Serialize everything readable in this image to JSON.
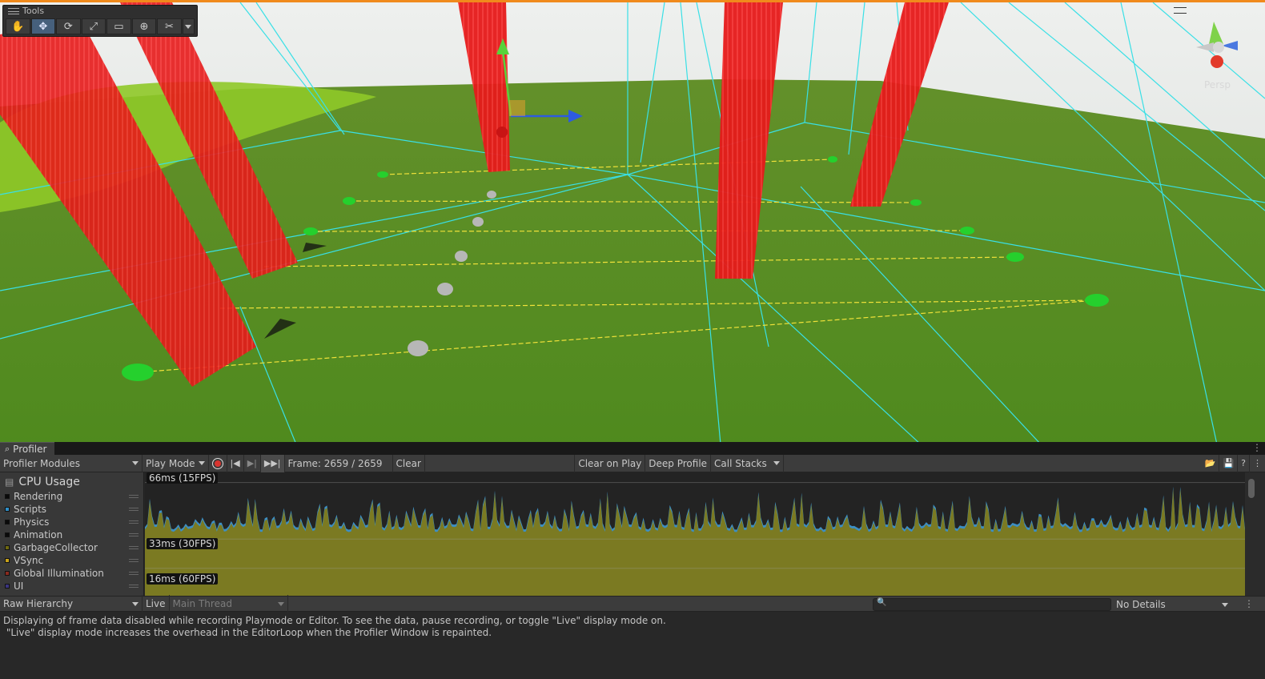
{
  "scene": {
    "tools_title": "Tools",
    "tool_icons": [
      "hand-icon",
      "move-icon",
      "rotate-icon",
      "scale-icon",
      "rect-icon",
      "transform-icon",
      "custom-tool-icon"
    ],
    "active_tool": "move-icon",
    "gizmo_label": "Persp"
  },
  "profiler": {
    "tab_title": "Profiler",
    "modules_dropdown": "Profiler Modules",
    "target_dropdown": "Play Mode",
    "frame_text": "Frame: 2659 / 2659",
    "clear_label": "Clear",
    "clear_on_play_label": "Clear on Play",
    "deep_profile_label": "Deep Profile",
    "call_stacks_label": "Call Stacks",
    "module_title": "CPU Usage",
    "modules": [
      {
        "label": "Rendering",
        "color": "#0a0a0a"
      },
      {
        "label": "Scripts",
        "color": "#2f8fc8"
      },
      {
        "label": "Physics",
        "color": "#0a0a0a"
      },
      {
        "label": "Animation",
        "color": "#0a0a0a"
      },
      {
        "label": "GarbageCollector",
        "color": "#6f6a10"
      },
      {
        "label": "VSync",
        "color": "#c8a21a"
      },
      {
        "label": "Global Illumination",
        "color": "#8a2a1e"
      },
      {
        "label": "UI",
        "color": "#3b3580"
      }
    ],
    "ticks": [
      "66ms (15FPS)",
      "33ms (30FPS)",
      "16ms (60FPS)"
    ],
    "hierarchy_dropdown": "Raw Hierarchy",
    "live_label": "Live",
    "thread_dropdown": "Main Thread",
    "details_dropdown": "No Details",
    "message_line1": "Displaying of frame data disabled while recording Playmode or Editor. To see the data, pause recording, or toggle \"Live\" display mode on.",
    "message_line2": " \"Live\" display mode increases the overhead in the EditorLoop when the Profiler Window is repainted."
  },
  "chart_data": {
    "type": "area",
    "ylabel": "",
    "yticks": [
      {
        "label": "66ms (15FPS)",
        "value": 66
      },
      {
        "label": "33ms (30FPS)",
        "value": 33
      },
      {
        "label": "16ms (60FPS)",
        "value": 16
      }
    ],
    "ylim": [
      0,
      70
    ],
    "series": [
      {
        "name": "Scripts",
        "color": "#3d8ec2"
      },
      {
        "name": "VSync",
        "color": "#7b7a22"
      }
    ],
    "baseline_ms": 40,
    "peaks_ms": [
      58,
      52,
      42,
      44,
      47,
      43,
      61,
      48,
      50,
      46,
      59,
      44,
      45,
      62,
      48,
      51,
      55,
      44,
      48,
      66,
      58,
      49,
      54,
      46,
      59,
      47,
      63,
      53,
      48,
      45,
      60,
      52,
      56,
      46,
      49,
      66,
      54,
      62,
      48,
      51,
      44,
      63,
      55,
      58,
      47,
      66,
      52,
      63,
      57,
      50,
      47,
      61,
      53,
      46,
      49,
      45,
      52,
      58,
      66,
      59,
      57,
      51,
      61
    ],
    "grid": true
  }
}
